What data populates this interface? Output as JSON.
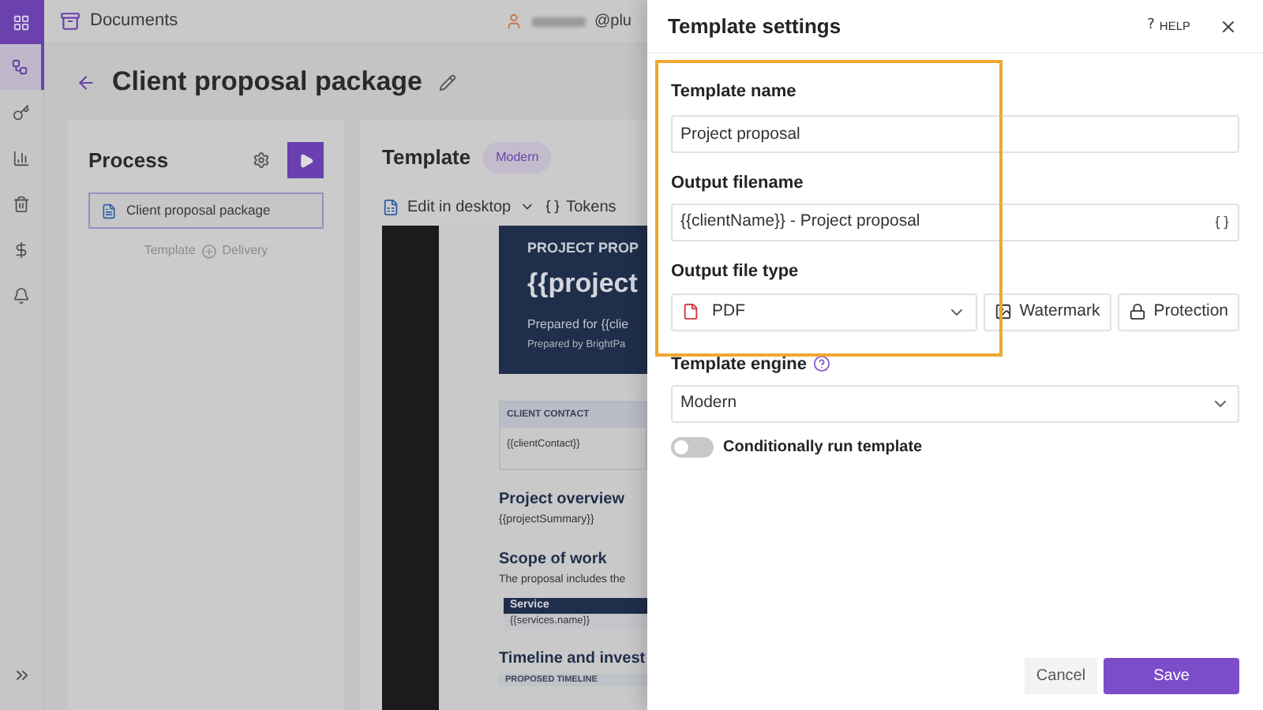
{
  "sidebar": {
    "items": [
      {
        "selected": true
      },
      {
        "selected": false
      },
      {
        "selected": false
      },
      {
        "selected": false
      },
      {
        "selected": false
      },
      {
        "selected": false
      }
    ]
  },
  "top_bar": {
    "app_name": "Documents",
    "user": "@plu"
  },
  "page": {
    "title": "Client proposal package"
  },
  "process": {
    "title": "Process",
    "step": "Client proposal package",
    "flow": [
      "Template",
      "Delivery"
    ]
  },
  "template": {
    "title": "Template",
    "badge": "Modern",
    "toolbar": [
      "Edit in desktop",
      "Tokens"
    ],
    "document": {
      "header_label": "PROJECT PROP",
      "header_title": "{{project",
      "prepared_for": "Prepared for {{clie",
      "prepared_by": "Prepared by BrightPa",
      "contact_label": "CLIENT CONTACT",
      "contact_value": "{{clientContact}}",
      "sections": [
        {
          "heading": "Project overview",
          "text": "{{projectSummary}}"
        },
        {
          "heading": "Scope of work",
          "text": "The proposal includes the",
          "table": {
            "header": "Service",
            "row": "{{services.name}}"
          }
        },
        {
          "heading": "Timeline and invest",
          "label": "PROPOSED TIMELINE"
        }
      ]
    }
  },
  "panel": {
    "title": "Template settings",
    "help_mark": "?",
    "help": "HELP",
    "fields": [
      {
        "kind": "text",
        "label": "Template name",
        "value": "Project proposal",
        "highlighted": true
      },
      {
        "kind": "token",
        "label": "Output filename",
        "value": "{{clientName}} - Project proposal",
        "highlighted": true
      },
      {
        "kind": "filetype",
        "label": "Output file type",
        "value": "PDF",
        "buttons": [
          "Watermark",
          "Protection"
        ],
        "highlighted": true
      },
      {
        "kind": "select",
        "label": "Template engine",
        "value": "Modern",
        "help": true,
        "highlighted": false
      }
    ],
    "toggle": {
      "label": "Conditionally run template",
      "on": false
    },
    "buttons": {
      "cancel": "Cancel",
      "save": "Save"
    }
  }
}
